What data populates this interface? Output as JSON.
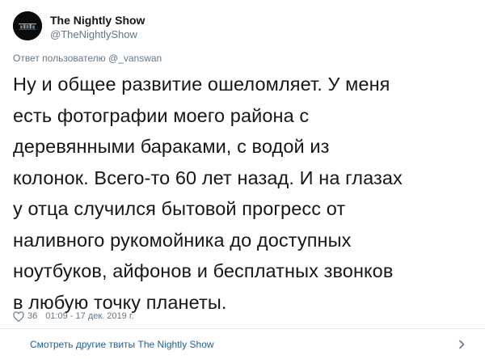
{
  "tweet": {
    "author": {
      "name": "The Nightly Show",
      "handle": "@TheNightlyShow"
    },
    "reply_context": "Ответ пользователю @_vanswan",
    "text_lines": [
      "Ну и общее развитие ошеломляет. У меня",
      "есть фотографии моего района с",
      "деревянными бараками, с водой из",
      "колонок. Всего-то 60 лет назад. И на глазах",
      "у отца случился бытовой прогресс от",
      "наливного рукомойника до доступных",
      "ноутбуков, айфонов и бесплатных звонков",
      "в любую точку планеты."
    ],
    "likes": "36",
    "timestamp": "01:09 - 17 дек. 2019 г."
  },
  "footer": {
    "link_text": "Смотреть другие твиты The Nightly Show"
  },
  "icons": {
    "like": "heart-icon",
    "more": "chevron-right-icon"
  },
  "colors": {
    "text": "#14171a",
    "secondary": "#657786",
    "link": "#1b5fa3",
    "divider": "#e6ecf0",
    "avatar_bg": "#0b0b0b"
  }
}
